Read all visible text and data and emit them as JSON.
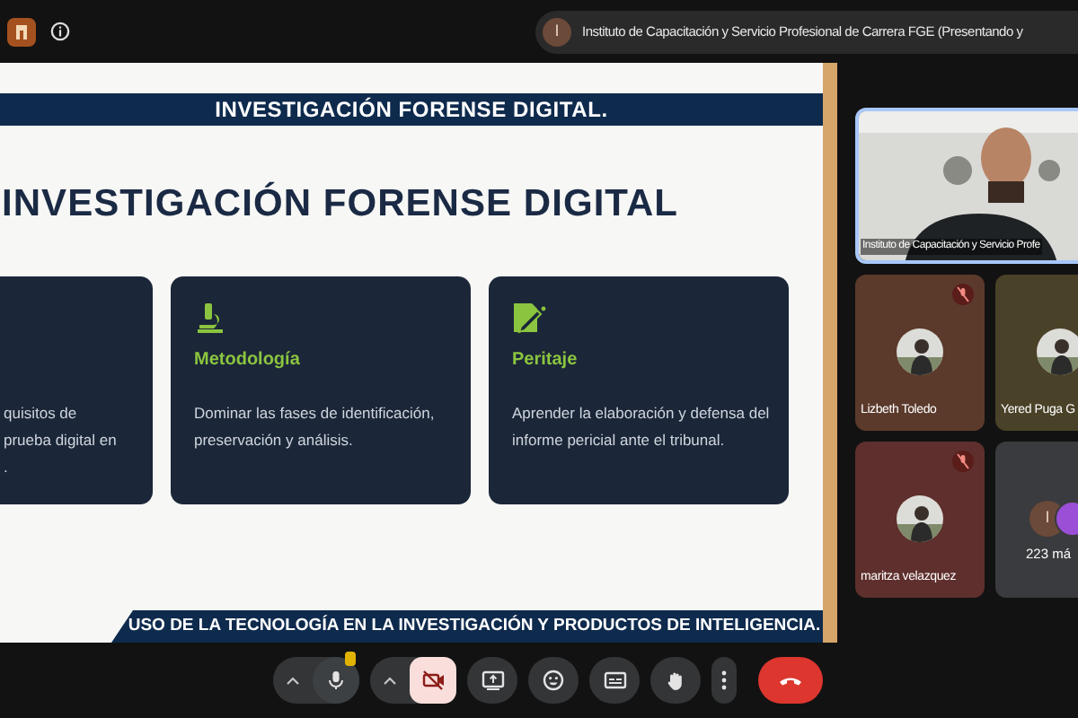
{
  "top_bar": {
    "presenter_initial": "I",
    "presenter_text": "Instituto de Capacitación y Servicio Profesional de Carrera FGE (Presentando y"
  },
  "slide": {
    "header": "INVESTIGACIÓN FORENSE DIGITAL.",
    "title": "INVESTIGACIÓN FORENSE DIGITAL",
    "cards": [
      {
        "kind": "partial",
        "lines": [
          "quisitos de",
          "prueba digital en",
          "."
        ]
      },
      {
        "kind": "microscope",
        "title": "Metodología",
        "lines": [
          "Dominar las fases de identificación,",
          "preservación y análisis."
        ]
      },
      {
        "kind": "report",
        "title": "Peritaje",
        "lines": [
          "Aprender la elaboración y defensa del",
          "informe pericial ante el tribunal."
        ]
      }
    ],
    "footer": "USO DE LA TECNOLOGÍA EN LA INVESTIGACIÓN Y PRODUCTOS DE INTELIGENCIA."
  },
  "participants": [
    {
      "kind": "video",
      "name": "Instituto de Capacitación y Servicio Profe"
    },
    {
      "kind": "avatar",
      "name": "Lizbeth Toledo",
      "muted": true,
      "color": "#5b3a2b"
    },
    {
      "kind": "avatar",
      "name": "Yered Puga G",
      "color": "#4a4228"
    },
    {
      "kind": "avatar",
      "name": "maritza velazquez",
      "muted": true,
      "color": "#5e2f2c"
    },
    {
      "kind": "overflow",
      "initial": "I",
      "count": "223 má",
      "color": "#3a3b3e"
    }
  ],
  "controls": [
    {
      "kind": "mic",
      "on": true
    },
    {
      "kind": "camera",
      "on": false
    },
    {
      "kind": "present"
    },
    {
      "kind": "emoji"
    },
    {
      "kind": "captions"
    },
    {
      "kind": "hand"
    },
    {
      "kind": "more"
    },
    {
      "kind": "end"
    }
  ]
}
